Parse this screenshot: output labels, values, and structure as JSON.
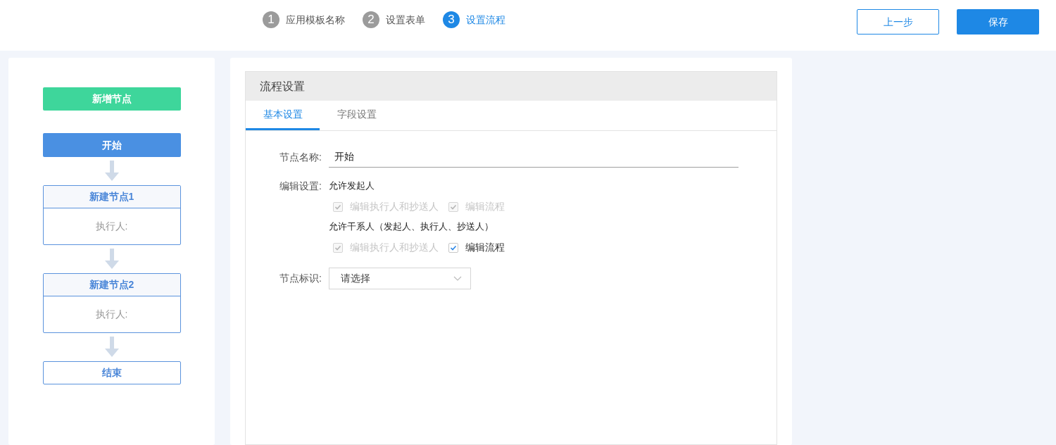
{
  "steps": [
    {
      "number": "1",
      "label": "应用模板名称",
      "selected": false
    },
    {
      "number": "2",
      "label": "设置表单",
      "selected": false
    },
    {
      "number": "3",
      "label": "设置流程",
      "selected": true
    }
  ],
  "header_buttons": [
    {
      "label": "上一步",
      "kind": "outline"
    },
    {
      "label": "保存",
      "kind": "primary"
    }
  ],
  "add_node_button": "新增节点",
  "flow_nodes": [
    {
      "kind": "start",
      "title": "开始",
      "selected": true
    },
    {
      "kind": "task",
      "title": "新建节点1",
      "assignee_label": "执行人:"
    },
    {
      "kind": "task",
      "title": "新建节点2",
      "assignee_label": "执行人:"
    },
    {
      "kind": "end",
      "title": "结束"
    }
  ],
  "panel": {
    "title": "流程设置",
    "tabs": [
      {
        "label": "基本设置",
        "selected": true
      },
      {
        "label": "字段设置",
        "selected": false
      }
    ],
    "node_name": {
      "label": "节点名称:",
      "value": "开始"
    },
    "edit_settings": {
      "label": "编辑设置:",
      "groups": [
        {
          "title": "允许发起人",
          "options": [
            {
              "label": "编辑执行人和抄送人",
              "checked": true,
              "disabled": true
            },
            {
              "label": "编辑流程",
              "checked": true,
              "disabled": true
            }
          ]
        },
        {
          "title": "允许干系人（发起人、执行人、抄送人）",
          "options": [
            {
              "label": "编辑执行人和抄送人",
              "checked": true,
              "disabled": true
            },
            {
              "label": "编辑流程",
              "checked": true,
              "disabled": false
            }
          ]
        }
      ]
    },
    "node_tag": {
      "label": "节点标识:",
      "placeholder": "请选择"
    }
  }
}
